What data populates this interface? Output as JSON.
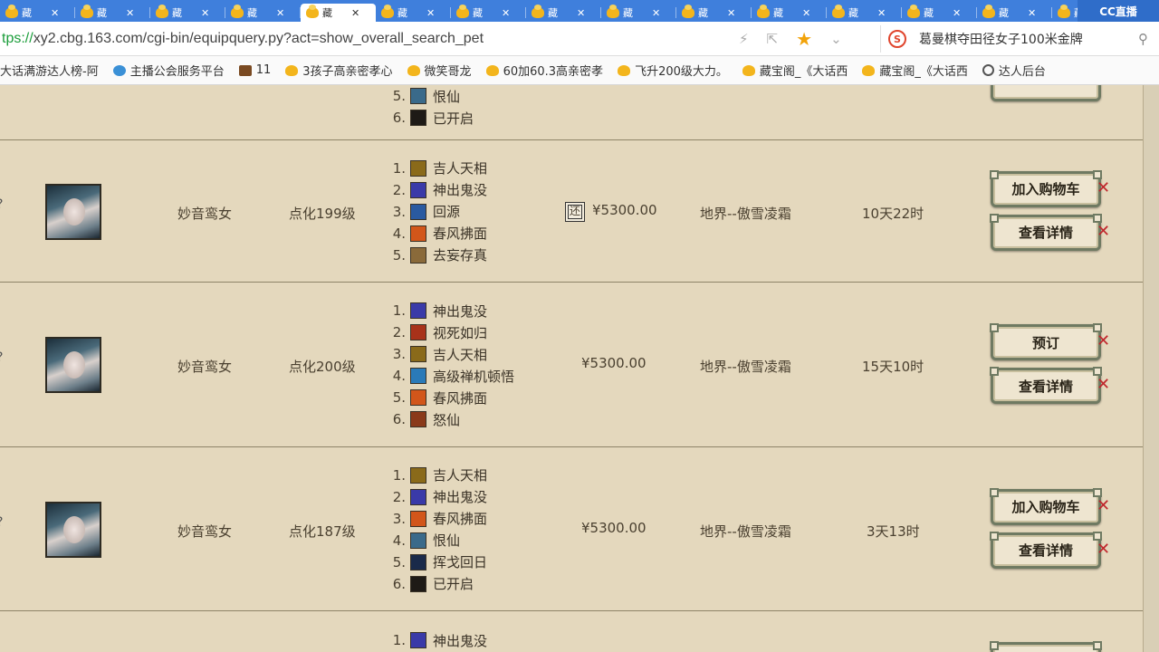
{
  "browser": {
    "tabs": [
      {
        "title": "藏"
      },
      {
        "title": "藏"
      },
      {
        "title": "藏"
      },
      {
        "title": "藏"
      },
      {
        "title": "藏",
        "active": true
      },
      {
        "title": "藏"
      },
      {
        "title": "藏"
      },
      {
        "title": "藏"
      },
      {
        "title": "藏"
      },
      {
        "title": "藏"
      },
      {
        "title": "藏"
      },
      {
        "title": "藏"
      },
      {
        "title": "藏"
      },
      {
        "title": "藏"
      },
      {
        "title": "藏"
      }
    ],
    "corner_label": "CC直播",
    "url_prefix": "tps://",
    "url_rest": "xy2.cbg.163.com/cgi-bin/equipquery.py?act=show_overall_search_pet",
    "search_text": "葛曼棋夺田径女子100米金牌",
    "bookmarks": [
      {
        "label": "大话满游达人榜-阿",
        "icon": "none"
      },
      {
        "label": "主播公会服务平台",
        "icon": "blue"
      },
      {
        "label": "11",
        "icon": "dark"
      },
      {
        "label": "3孩子高亲密孝心",
        "icon": "yellow"
      },
      {
        "label": "微笑哥龙",
        "icon": "yellow"
      },
      {
        "label": "60加60.3高亲密孝",
        "icon": "yellow"
      },
      {
        "label": "飞升200级大力。",
        "icon": "yellow"
      },
      {
        "label": "藏宝阁_《大话西",
        "icon": "yellow"
      },
      {
        "label": "藏宝阁_《大话西",
        "icon": "yellow"
      },
      {
        "label": "达人后台",
        "icon": "globe"
      }
    ]
  },
  "listing": {
    "partial_top": {
      "skills": [
        {
          "n": "5.",
          "name": "恨仙",
          "color": "#3a6a8a"
        },
        {
          "n": "6.",
          "name": "已开启",
          "color": "#1e1a16"
        }
      ]
    },
    "rows": [
      {
        "name": "妙音鸾女",
        "level": "点化199级",
        "price": "¥5300.00",
        "refund_icon": "还",
        "server": "地界--傲雪凌霜",
        "time_left": "10天22时",
        "button1": "加入购物车",
        "button2": "查看详情",
        "skills": [
          {
            "n": "1.",
            "name": "吉人天相",
            "color": "#8a6a1a"
          },
          {
            "n": "2.",
            "name": "神出鬼没",
            "color": "#3a3aa8"
          },
          {
            "n": "3.",
            "name": "回源",
            "color": "#2a5aa0"
          },
          {
            "n": "4.",
            "name": "春风拂面",
            "color": "#d2561a"
          },
          {
            "n": "5.",
            "name": "去妄存真",
            "color": "#8a6a3a"
          }
        ]
      },
      {
        "name": "妙音鸾女",
        "level": "点化200级",
        "price": "¥5300.00",
        "server": "地界--傲雪凌霜",
        "time_left": "15天10时",
        "button1": "预订",
        "button2": "查看详情",
        "skills": [
          {
            "n": "1.",
            "name": "神出鬼没",
            "color": "#3a3aa8"
          },
          {
            "n": "2.",
            "name": "视死如归",
            "color": "#a8321a"
          },
          {
            "n": "3.",
            "name": "吉人天相",
            "color": "#8a6a1a"
          },
          {
            "n": "4.",
            "name": "高级禅机顿悟",
            "color": "#2a7ab8"
          },
          {
            "n": "5.",
            "name": "春风拂面",
            "color": "#d2561a"
          },
          {
            "n": "6.",
            "name": "怒仙",
            "color": "#8a3a1a"
          }
        ]
      },
      {
        "name": "妙音鸾女",
        "level": "点化187级",
        "price": "¥5300.00",
        "server": "地界--傲雪凌霜",
        "time_left": "3天13时",
        "button1": "加入购物车",
        "button2": "查看详情",
        "skills": [
          {
            "n": "1.",
            "name": "吉人天相",
            "color": "#8a6a1a"
          },
          {
            "n": "2.",
            "name": "神出鬼没",
            "color": "#3a3aa8"
          },
          {
            "n": "3.",
            "name": "春风拂面",
            "color": "#d2561a"
          },
          {
            "n": "4.",
            "name": "恨仙",
            "color": "#3a6a8a"
          },
          {
            "n": "5.",
            "name": "挥戈回日",
            "color": "#1a2a4a"
          },
          {
            "n": "6.",
            "name": "已开启",
            "color": "#1e1a16"
          }
        ]
      }
    ],
    "partial_bottom": {
      "skills": [
        {
          "n": "1.",
          "name": "神出鬼没",
          "color": "#3a3aa8"
        }
      ]
    }
  },
  "colors": {
    "page_bg": "#e4d8bd",
    "row_border": "#8e8468",
    "button_border": "#6f7a62",
    "pin_red": "#c0272d",
    "tab_blue": "#3f7fdc"
  }
}
